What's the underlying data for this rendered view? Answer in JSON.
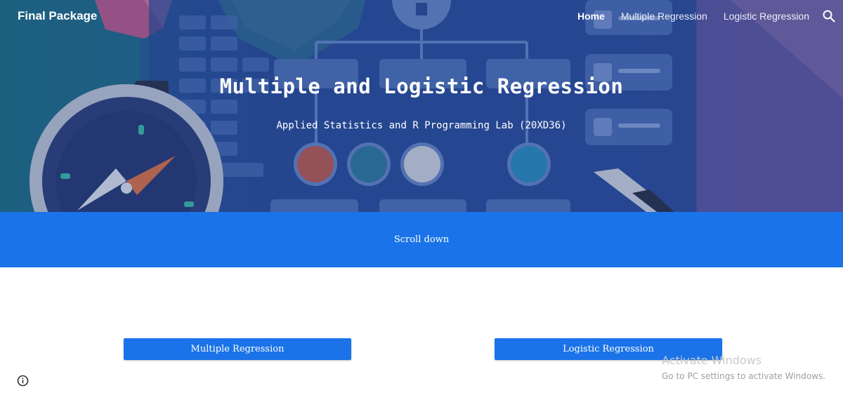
{
  "header": {
    "site_title": "Final Package",
    "nav": [
      "Home",
      "Multiple Regression",
      "Logistic Regression"
    ],
    "active_nav": "Home"
  },
  "hero": {
    "title": "Multiple and Logistic Regression",
    "subtitle": "Applied Statistics and R Programming Lab (20XD36)"
  },
  "band": {
    "scroll_label": "Scroll down"
  },
  "buttons": {
    "multiple_regression": "Multiple Regression",
    "logistic_regression": "Logistic Regression"
  },
  "watermark": {
    "title": "Activate Windows",
    "subtitle": "Go to PC settings to activate Windows."
  },
  "colors": {
    "accent": "#1a73e8",
    "hero_overlay": "#2e56a6"
  },
  "icons": [
    "search-icon",
    "info-icon"
  ]
}
